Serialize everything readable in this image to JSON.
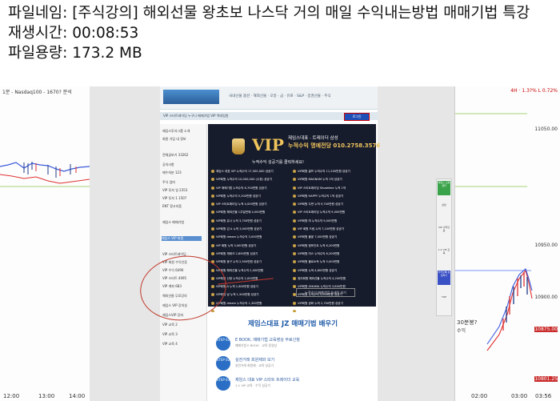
{
  "info": {
    "filename_label": "파일네임: ",
    "filename_value": "[주식강의] 해외선물 왕초보 나스닥 거의 매일 수익내는방법 매매기법 특강",
    "playtime_label": "재생시간: ",
    "playtime_value": "00:08:53",
    "filesize_label": "파일용량: ",
    "filesize_value": "173.2 MB"
  },
  "left_chart": {
    "title": "1분 - Nasdaq100 - 1670? 분석",
    "x_ticks": [
      "12:00",
      "13:00",
      "14:00"
    ]
  },
  "right_chart": {
    "top_text": "4H · 1.3?% L 0.72%",
    "y_ticks": [
      "11050.00",
      "10950.00",
      "10900.00",
      "10875.00",
      "10801.25"
    ],
    "x_ticks": [
      "02:00",
      "03:00",
      "03:56"
    ],
    "overlay_text": "30분봉?",
    "overlay_text2": "수익"
  },
  "website": {
    "nav_text": "국내선물 옵션 · 해외선물 · 오일 · 금 · 유로 · S&P · 증권선물 · 주식",
    "tabs": "VIP 스타트레이딩    누구나 매매기법    VIP 역대팀원",
    "login_button": "로그인",
    "sidebar": [
      "제임스투자그룹 소개",
      "회원 가입  내 정보",
      "전체글보기  33262",
      "공지사항",
      "매수처분  123",
      "주식 엄마",
      "VIP 투자 일  2353",
      "VIP 투자 1  1507",
      "ENT 알고리즘",
      "제임스 매매기법",
      "제임스 VIP 회원",
      "VIP 스타트레이딩",
      "VIP 회원 수익인증",
      "VIP 수익  6490",
      "VIP 스타트 4095",
      "VIP 계좌  683",
      "해외선물 무료강의",
      "제임스 VIP 강의실",
      "제임스VIP 강좌",
      "VIP 교육 2",
      "VIP 교육 3",
      "VIP 교육 4"
    ],
    "vip": {
      "logo": "VIP",
      "hof_line1": "제임스대표 · 트레이더 삼성",
      "hof_line2": "누적수익 명예전당 010.2758.3576",
      "sub": "누적수익 성공기를 클릭하세요!",
      "rows_left": [
        "제임스 대표 VIP 누적수익 17,500,000 성공기",
        "VIP회원 누적수익 10,000,000 (수정) 성공기",
        "VIP 매매기법 누적수익 6,700만원 성공기",
        "VIP회원 누적수익 5,200만원 성공기",
        "VIP 스타트레이딩 누적 4,000만원 성공기",
        "VIP회원 해외선물 1주일만에 4,000만원",
        "VIP회원 유나 누적 3,700만원 성공기",
        "VIP회원 김 A 누적 3,000만원 성공기",
        "VIP회원 dream 누적수익 3,000만원",
        "VIP 회원 누적 3,000만원 성공기",
        "VIP회원 재테크 2,800만원 성공기",
        "VIP회원 동구 누적 2,500만원 성공기",
        "VIP회원 해외선물 누적수익 2,000만원",
        "VIP회원 신정 누적수익 2,000만원",
        "VIP회원 A 누적 1,800만원 성공기",
        "VIP회원 남 누적 1,500만원 성공기",
        "VIP회원 dream 누적수익 1,300만원",
        "VIP회원 누적수익 2,000만원 성공기",
        "VIP회원 누적 1,200만원 성공기"
      ],
      "rows_right": [
        "VIP회원 골프 누적수익 11,200만원 성공기",
        "VIP회원 MAGNUM 누적 1억 성공기",
        "VIP 스타트레이딩 Showtime 누적 1억",
        "VIP회원 HAPPY 누적수익 1억 성공기",
        "VIP회원 두번 누적 9,700만원 성공기",
        "VIP 스타트레이딩 누적수익 9,000만원",
        "VIP회원 마 누적수익 9,000만원",
        "VIP 회원 드림 누적 7,100만원 성공기",
        "VIP회원 불꽃 7,000만원 성공기",
        "VIP회원 엠포인트 누적 6,200만원",
        "VIP회원 미스 누적수익 6,200만원",
        "VIP회원 불로소득 누적 5,000만원",
        "VIP회원 누적 4,800만원 성공기",
        "정리회원 해외선물 누적수익 4,200만원",
        "VIP회원 GMAMA 누적수익 3,800만원",
        "VIP회원 누적수익 3,000만원 성공기",
        "VIP회원 공화 누적 2,700만원 성공기",
        "누적수익 해외선물 VIP 회원 성공기"
      ],
      "more_button": "누적수익 매매기법 자세히 보기"
    },
    "learn": {
      "title": "제임스대표 JZ 매매기법 배우기",
      "steps": [
        {
          "badge": "STEP 01",
          "title": "E BOOK, 매매기법 교육영상 무료신청",
          "sub": "매매기법 E BOOK · 교육 동영상"
        },
        {
          "badge": "STEP 02",
          "title": "실전거래 회원제와 보기",
          "sub": "실전거래 회원제 · 교육 성공기"
        },
        {
          "badge": "STEP 03",
          "title": "제임스 대표 VIP 스타트 트레이더 교육",
          "sub": "1:1 VIP 교육 · 수익 성공기"
        }
      ]
    },
    "floatbar": [
      "제임스 교육센터",
      "상담",
      "VIP 수익인증",
      "1:1 VIP 교육",
      "카카오톡 상담하기",
      "TOP"
    ]
  },
  "colors": {
    "vip_bg": "#171c2d",
    "gold": "#f0c45c",
    "annotation": "#c0392b",
    "brand_blue": "#1f5aa8"
  }
}
